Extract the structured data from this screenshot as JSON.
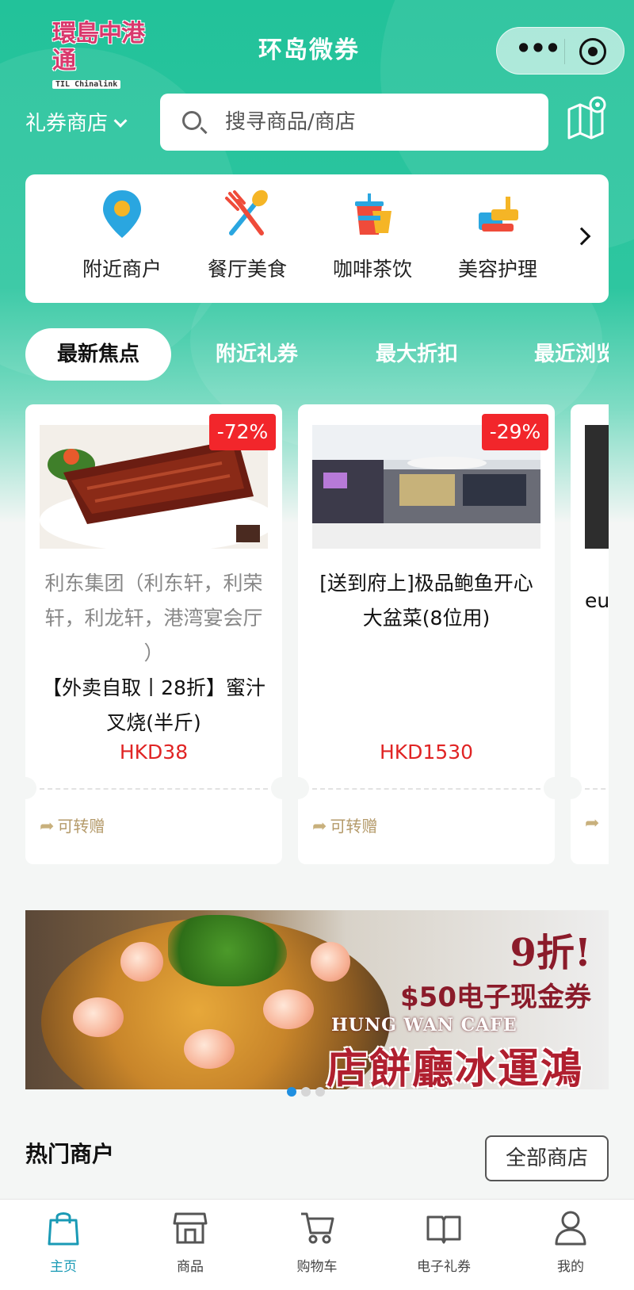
{
  "header": {
    "logo_cn": "環島中港通",
    "logo_en": "TIL Chinalink",
    "title": "环岛微券",
    "more_icon": "more-dots-icon",
    "close_icon": "target-circle-icon"
  },
  "search": {
    "store_select_label": "礼券商店",
    "placeholder": "搜寻商品/商店",
    "map_icon": "map-pin-icon"
  },
  "categories": {
    "items": [
      {
        "label": "附近商户",
        "icon": "location-pin-icon"
      },
      {
        "label": "餐厅美食",
        "icon": "fork-spoon-icon"
      },
      {
        "label": "咖啡茶饮",
        "icon": "drink-cup-icon"
      },
      {
        "label": "美容护理",
        "icon": "beauty-icon"
      }
    ],
    "next_icon": "chevron-right-icon"
  },
  "tabs": [
    {
      "label": "最新焦点",
      "active": true
    },
    {
      "label": "附近礼券",
      "active": false
    },
    {
      "label": "最大折扣",
      "active": false
    },
    {
      "label": "最近浏览",
      "active": false
    }
  ],
  "products": [
    {
      "badge": "-72%",
      "merchant": "利东集团（利东轩，利荣轩，利龙轩，港湾宴会厅 ）",
      "name": "【外卖自取丨28折】蜜汁叉烧(半斤)",
      "price": "HKD38",
      "gift_label": "可转赠"
    },
    {
      "badge": "-29%",
      "merchant": "",
      "name": "[送到府上]极品鲍鱼开心大盆菜(8位用)",
      "price": "HKD1530",
      "gift_label": "可转赠"
    },
    {
      "badge": "",
      "merchant": "",
      "name": "eu",
      "price": "",
      "gift_label": ""
    }
  ],
  "banner": {
    "discount": "9折!",
    "voucher": "$50电子现金券",
    "cafe_en": "HUNG WAN CAFE",
    "cafe_cn": "店餅廳冰運鴻",
    "slides": 3,
    "active_slide": 1
  },
  "hot_merchants": {
    "title": "热门商户",
    "all_button": "全部商店"
  },
  "bottom_nav": [
    {
      "label": "主页",
      "icon": "shopping-bag-icon",
      "active": true
    },
    {
      "label": "商品",
      "icon": "storefront-icon",
      "active": false
    },
    {
      "label": "购物车",
      "icon": "cart-icon",
      "active": false
    },
    {
      "label": "电子礼券",
      "icon": "open-book-icon",
      "active": false
    },
    {
      "label": "我的",
      "icon": "user-icon",
      "active": false
    }
  ],
  "colors": {
    "brand_green": "#22c29a",
    "price_red": "#e02424",
    "badge_red": "#f2262b",
    "active_nav": "#1a9ab5"
  }
}
